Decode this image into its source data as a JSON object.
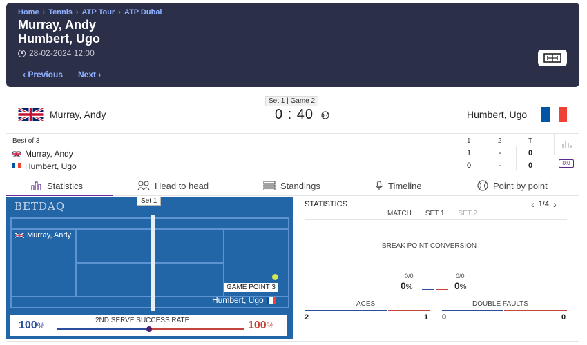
{
  "header": {
    "breadcrumb": [
      "Home",
      "Tennis",
      "ATP Tour",
      "ATP Dubai"
    ],
    "player1": "Murray, Andy",
    "player2": "Humbert, Ugo",
    "datetime": "28-02-2024 12:00",
    "prev_label": "‹  Previous",
    "next_label": "Next  ›"
  },
  "scoreboard": {
    "set_game": "Set 1 | Game 2",
    "score": "0 : 40",
    "player1": "Murray, Andy",
    "player2": "Humbert, Ugo"
  },
  "score_table": {
    "best_of": "Best of 3",
    "columns": [
      "1",
      "2",
      "T"
    ],
    "rows": [
      {
        "name": "Murray, Andy",
        "set1": "1",
        "set2": "-",
        "total": "0"
      },
      {
        "name": "Humbert, Ugo",
        "set1": "0",
        "set2": "-",
        "total": "0"
      }
    ],
    "court_badge": "0:0"
  },
  "tabs": [
    "Statistics",
    "Head to head",
    "Standings",
    "Timeline",
    "Point by point"
  ],
  "court": {
    "brand": "BETDAQ",
    "set_label": "Set 1",
    "player1": "Murray, Andy",
    "player2": "Humbert, Ugo",
    "game_point": "GAME POINT 3",
    "serve_label": "2ND SERVE SUCCESS RATE",
    "serve_left": "100",
    "serve_right": "100",
    "percent": "%"
  },
  "stats": {
    "title": "STATISTICS",
    "page": "1/4",
    "periods": [
      "MATCH",
      "SET 1",
      "SET 2"
    ],
    "break_point_label": "BREAK POINT CONVERSION",
    "bp_left_frac": "0/0",
    "bp_right_frac": "0/0",
    "bp_left": "0",
    "bp_right": "0",
    "aces_label": "ACES",
    "aces_left": "2",
    "aces_right": "1",
    "df_label": "DOUBLE FAULTS",
    "df_left": "0",
    "df_right": "0"
  },
  "colors": {
    "header_bg": "#2c2f48",
    "link": "#8fb0ff",
    "accent": "#6a2a9a",
    "player1_color": "#2a4d9c",
    "player2_color": "#c4453c",
    "court": "#2266a8"
  }
}
